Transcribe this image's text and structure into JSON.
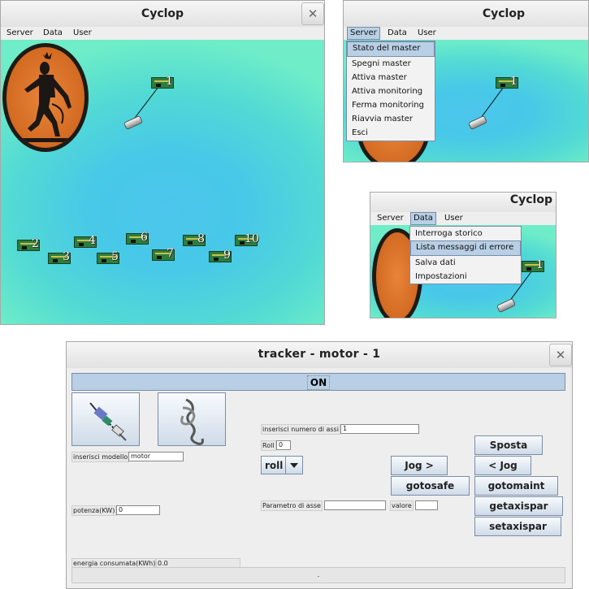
{
  "main_window": {
    "title": "Cyclop",
    "close_label": "✕",
    "menus": [
      "Server",
      "Data",
      "User"
    ],
    "boards": [
      "1",
      "2",
      "3",
      "4",
      "5",
      "6",
      "7",
      "8",
      "9",
      "10"
    ]
  },
  "server_window": {
    "title": "Cyclop",
    "menus": [
      "Server",
      "Data",
      "User"
    ],
    "board_label": "1",
    "dropdown": [
      "Stato del master",
      "Spegni master",
      "Attiva master",
      "Attiva monitoring",
      "Ferma monitoring",
      "Riavvia master",
      "Esci"
    ],
    "highlighted": "Stato del master"
  },
  "data_window": {
    "title": "Cyclop",
    "menus": [
      "Server",
      "Data",
      "User"
    ],
    "board_label": "1",
    "dropdown": [
      "Interroga storico",
      "Lista messaggi di errore",
      "Salva dati",
      "Impostazioni"
    ],
    "highlighted": "Lista messaggi di errore"
  },
  "tracker_window": {
    "title": "tracker - motor - 1",
    "close_label": "✕",
    "status": "ON",
    "model_label": "inserisci modello",
    "model_value": "motor",
    "power_label": "potenza(KW)",
    "power_value": "0",
    "energy_label": "energia consumata(KWh)",
    "energy_value": "0.0",
    "axes_label": "inserisci numero di assi",
    "axes_value": "1",
    "roll_label": "Roll",
    "roll_value": "0",
    "select_value": "roll",
    "param_label": "Parametro di asse",
    "param_value": "",
    "valore_label": "valore",
    "valore_value": "",
    "buttons": {
      "jog_plus": "Jog >",
      "gotosafe": "gotosafe",
      "sposta": "Sposta",
      "jog_minus": "< Jog",
      "gotomaint": "gotomaint",
      "getaxispar": "getaxispar",
      "setaxispar": "setaxispar"
    },
    "status_text": "."
  },
  "colors": {
    "selection": "#b8cfe5",
    "canvas": "#47c9e8",
    "vase": "#d36a22"
  }
}
